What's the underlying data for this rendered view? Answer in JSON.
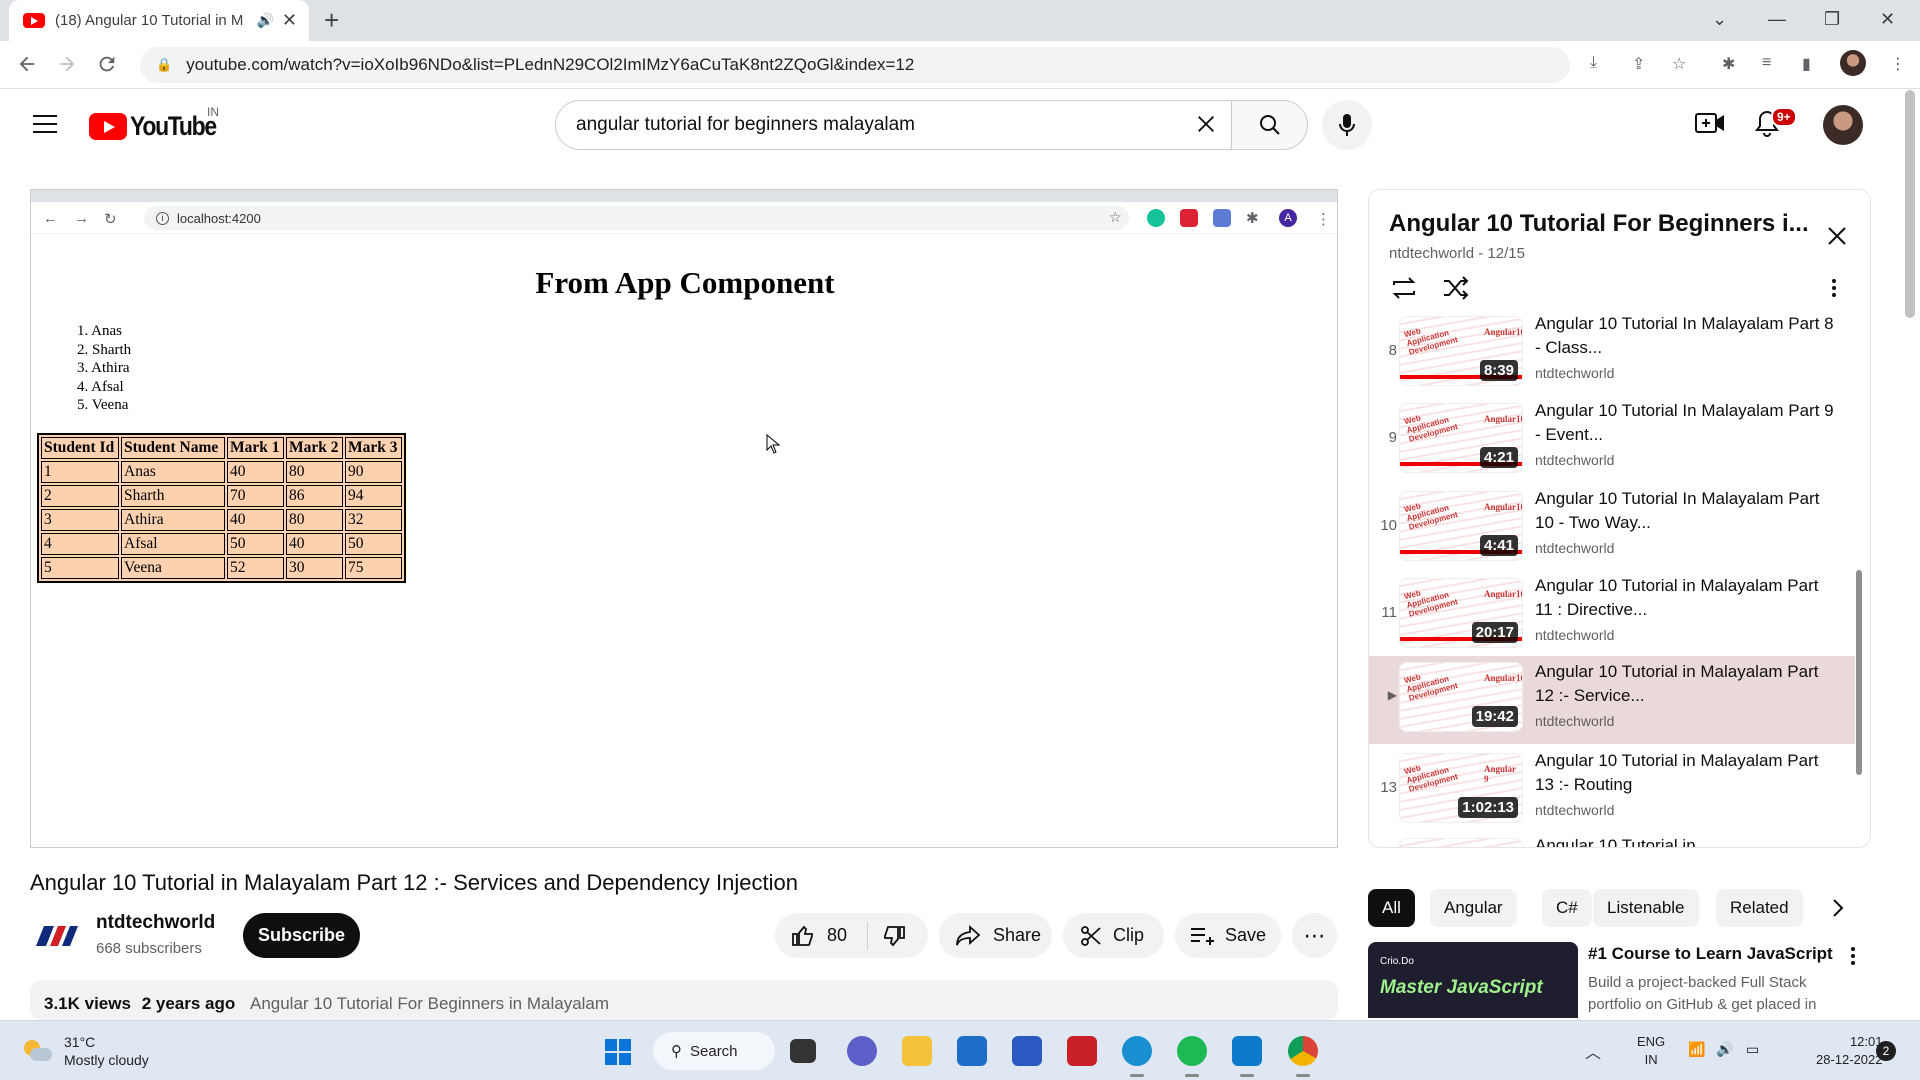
{
  "browser": {
    "tab_title": "(18) Angular 10 Tutorial in M",
    "url": "youtube.com/watch?v=ioXoIb96NDo&list=PLednN29COl2ImIMzY6aCuTaK8nt2ZQoGl&index=12"
  },
  "masthead": {
    "logo_text": "YouTube",
    "region": "IN",
    "search_value": "angular tutorial for beginners malayalam",
    "notification_count": "9+"
  },
  "video_frame": {
    "inner_url": "localhost:4200",
    "inner_profile_letter": "A",
    "heading": "From App Component",
    "ordered_list": [
      "1. Anas",
      "2. Sharth",
      "3. Athira",
      "4. Afsal",
      "5. Veena"
    ],
    "table": {
      "headers": [
        "Student Id",
        "Student Name",
        "Mark 1",
        "Mark 2",
        "Mark 3"
      ],
      "rows": [
        [
          "1",
          "Anas",
          "40",
          "80",
          "90"
        ],
        [
          "2",
          "Sharth",
          "70",
          "86",
          "94"
        ],
        [
          "3",
          "Athira",
          "40",
          "80",
          "32"
        ],
        [
          "4",
          "Afsal",
          "50",
          "40",
          "50"
        ],
        [
          "5",
          "Veena",
          "52",
          "30",
          "75"
        ]
      ]
    }
  },
  "video_info": {
    "title": "Angular 10 Tutorial in Malayalam Part 12 :- Services and Dependency Injection",
    "channel": "ntdtechworld",
    "subscribers": "668 subscribers",
    "subscribe_label": "Subscribe",
    "likes": "80",
    "share_label": "Share",
    "clip_label": "Clip",
    "save_label": "Save",
    "views": "3.1K views",
    "age": "2 years ago",
    "playlist_link": "Angular 10  Tutorial  For Beginners in Malayalam"
  },
  "playlist": {
    "title": "Angular 10  Tutorial  For Beginners i...",
    "subtitle": "ntdtechworld - 12/15",
    "items": [
      {
        "index": "8",
        "title": "Angular 10 Tutorial In Malayalam Part 8 - Class...",
        "channel": "ntdtechworld",
        "duration": "8:39"
      },
      {
        "index": "9",
        "title": "Angular 10 Tutorial In Malayalam Part 9 - Event...",
        "channel": "ntdtechworld",
        "duration": "4:21"
      },
      {
        "index": "10",
        "title": "Angular 10 Tutorial In Malayalam Part 10 - Two Way...",
        "channel": "ntdtechworld",
        "duration": "4:41"
      },
      {
        "index": "11",
        "title": "Angular 10 Tutorial in Malayalam Part 11 : Directive...",
        "channel": "ntdtechworld",
        "duration": "20:17"
      },
      {
        "index": "▶",
        "title": "Angular 10 Tutorial in Malayalam Part 12 :- Service...",
        "channel": "ntdtechworld",
        "duration": "19:42"
      },
      {
        "index": "13",
        "title": "Angular 10 Tutorial in Malayalam Part 13 :- Routing",
        "channel": "ntdtechworld",
        "duration": "1:02:13"
      },
      {
        "index": "",
        "title": "Angular 10 Tutorial in",
        "channel": "",
        "duration": ""
      }
    ]
  },
  "chips": [
    "All",
    "Angular",
    "C#",
    "Listenable",
    "Related"
  ],
  "recommendation": {
    "thumb_brand": "Crio.Do",
    "thumb_text": "Master JavaScript",
    "title": "#1 Course to Learn JavaScript",
    "description": "Build a project-backed Full Stack portfolio on GitHub & get placed in"
  },
  "taskbar": {
    "temperature": "31°C",
    "weather": "Mostly cloudy",
    "search_label": "Search",
    "lang": "ENG",
    "region": "IN",
    "time": "12:01",
    "date": "28-12-2022",
    "notifications": "2"
  },
  "colors": {
    "youtube_red": "#ff0000",
    "table_bg": "#fcd1b0",
    "active_playlist_bg": "#ead9da"
  }
}
